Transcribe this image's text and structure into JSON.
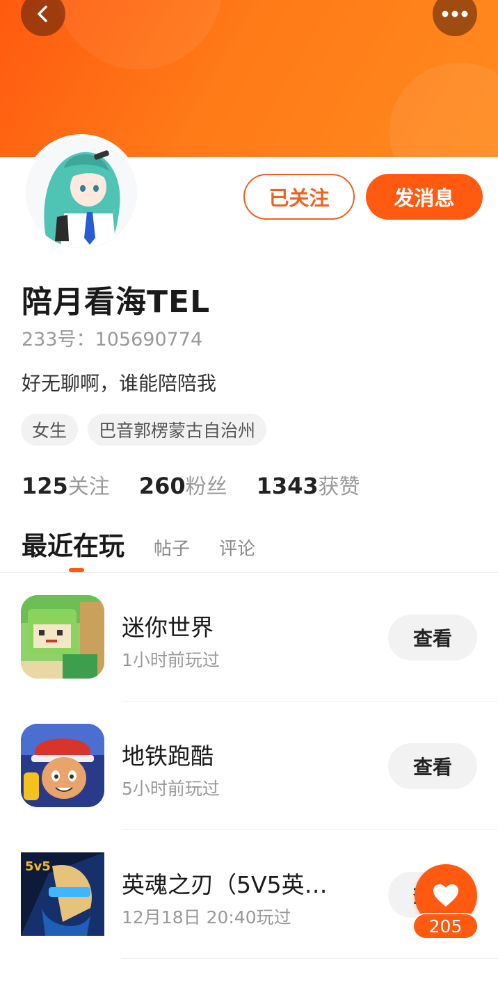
{
  "profile": {
    "name": "陪月看海TEL",
    "id_label": "233号：",
    "id_value": "105690774",
    "bio": "好无聊啊，谁能陪陪我",
    "tags": [
      "女生",
      "巴音郭楞蒙古自治州"
    ]
  },
  "actions": {
    "follow_label": "已关注",
    "message_label": "发消息"
  },
  "stats": [
    {
      "value": "125",
      "label": "关注"
    },
    {
      "value": "260",
      "label": "粉丝"
    },
    {
      "value": "1343",
      "label": "获赞"
    }
  ],
  "tabs": [
    "最近在玩",
    "帖子",
    "评论"
  ],
  "games": [
    {
      "title": "迷你世界",
      "time": "1小时前玩过",
      "button": "查看"
    },
    {
      "title": "地铁跑酷",
      "time": "5小时前玩过",
      "button": "查看"
    },
    {
      "title": "英魂之刃（5V5英…",
      "time": "12月18日 20:40玩过",
      "button": "查看"
    }
  ],
  "like": {
    "count": "205"
  },
  "icons": {
    "back": "chevron-left-icon",
    "more": "more-dots-icon",
    "like": "heart-icon"
  },
  "colors": {
    "accent": "#ff5a0f",
    "follow_border": "#f0601e"
  }
}
